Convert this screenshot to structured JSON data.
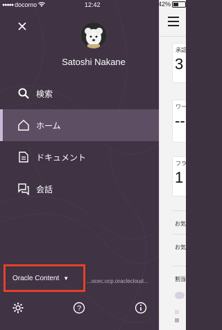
{
  "status_bar": {
    "carrier": "docomo",
    "time": "12:42",
    "battery": "42%"
  },
  "drawer": {
    "user_name": "Satoshi Nakane",
    "nav_items": [
      {
        "label": "検索",
        "icon": "search-icon",
        "active": false
      },
      {
        "label": "ホーム",
        "icon": "home-icon",
        "active": true
      },
      {
        "label": "ドキュメント",
        "icon": "documents-icon",
        "active": false
      },
      {
        "label": "会話",
        "icon": "conversation-icon",
        "active": false
      }
    ],
    "product_switcher": "Oracle Content",
    "server_url": "...ocec.ocp.oraclecloud...",
    "footer_icons": [
      "settings-icon",
      "help-icon",
      "info-icon"
    ]
  },
  "background_app": {
    "cards": [
      {
        "label": "承認",
        "value": "3"
      },
      {
        "label": "ワー",
        "value": "--"
      },
      {
        "label": "フラ",
        "value": "1"
      }
    ],
    "rows": [
      "お気",
      "お気",
      "割当"
    ]
  },
  "colors": {
    "drawer_bg": "#3f3344",
    "active_bg": "#5e4e64",
    "highlight_border": "#e8402a"
  }
}
